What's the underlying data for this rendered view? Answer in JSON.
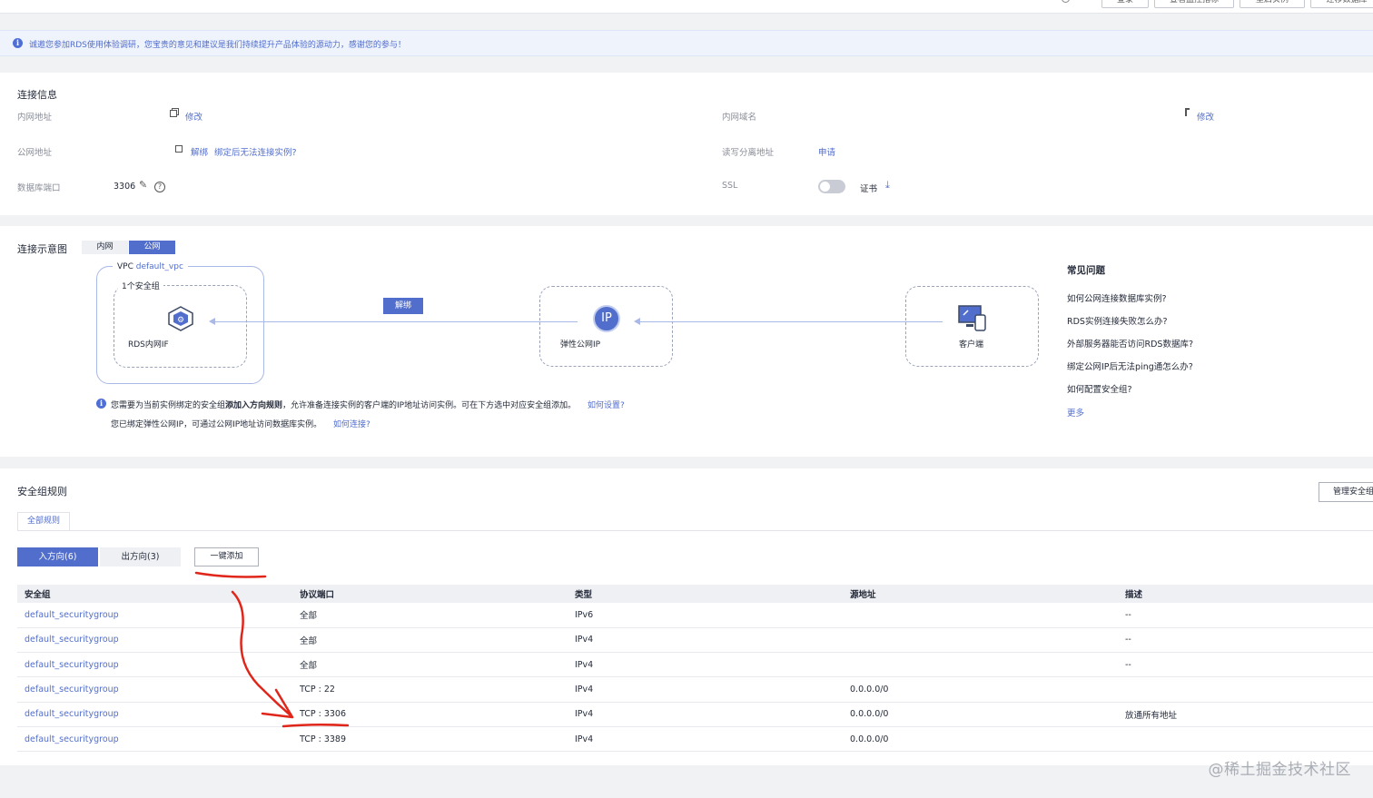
{
  "header": {
    "buttons": [
      {
        "label": "登录"
      },
      {
        "label": "查看监控指标"
      },
      {
        "label": "重启实例"
      },
      {
        "label": "迁移数据库"
      }
    ]
  },
  "banner": {
    "text": "诚邀您参加RDS使用体验调研，您宝贵的意见和建议是我们持续提升产品体验的源动力，感谢您的参与！"
  },
  "connection": {
    "title": "连接信息",
    "private_addr_label": "内网地址",
    "modify": "修改",
    "private_domain_label": "内网域名",
    "public_addr_label": "公网地址",
    "unbind": "解绑",
    "cannot_connect_link": "绑定后无法连接实例?",
    "rw_split_label": "读写分离地址",
    "apply": "申请",
    "port_label": "数据库端口",
    "port_value": "3306",
    "ssl_label": "SSL",
    "ssl_enabled": false,
    "cert_label": "证书"
  },
  "diagram": {
    "title": "连接示意图",
    "tabs": [
      {
        "label": "内网",
        "active": false
      },
      {
        "label": "公网",
        "active": true
      }
    ],
    "vpc_label": "VPC",
    "vpc_name": "default_vpc",
    "security_group_count": "1个安全组",
    "rds_label": "RDS内网IF",
    "unbind_badge": "解绑",
    "eip_label": "弹性公网IP",
    "eip_icon_text": "IP",
    "client_label": "客户端",
    "note1_a": "您需要为当前实例绑定的安全组",
    "note1_b": "添加入方向规则",
    "note1_c": "，允许准备连接实例的客户端的IP地址访问实例。可在下方选中对应安全组添加。",
    "note1_link": "如何设置?",
    "note2": "您已绑定弹性公网IP，可通过公网IP地址访问数据库实例。",
    "note2_link": "如何连接?"
  },
  "faq": {
    "title": "常见问题",
    "items": [
      "如何公网连接数据库实例?",
      "RDS实例连接失败怎么办?",
      "外部服务器能否访问RDS数据库?",
      "绑定公网IP后无法ping通怎么办?",
      "如何配置安全组?"
    ],
    "more": "更多"
  },
  "security": {
    "title": "安全组规则",
    "manage_button": "管理安全组",
    "filter_tab": "全部规则",
    "direction_tabs": [
      {
        "label": "入方向(6)",
        "active": true
      },
      {
        "label": "出方向(3)",
        "active": false
      }
    ],
    "quick_add": "一键添加",
    "columns": [
      "安全组",
      "协议端口",
      "类型",
      "源地址",
      "描述"
    ],
    "rows": [
      {
        "group": "default_securitygroup",
        "port": "全部",
        "type": "IPv6",
        "source": "",
        "desc": "--"
      },
      {
        "group": "default_securitygroup",
        "port": "全部",
        "type": "IPv4",
        "source": "",
        "desc": "--"
      },
      {
        "group": "default_securitygroup",
        "port": "全部",
        "type": "IPv4",
        "source": "",
        "desc": "--"
      },
      {
        "group": "default_securitygroup",
        "port": "TCP : 22",
        "type": "IPv4",
        "source": "0.0.0.0/0",
        "desc": ""
      },
      {
        "group": "default_securitygroup",
        "port": "TCP : 3306",
        "type": "IPv4",
        "source": "0.0.0.0/0",
        "desc": "放通所有地址"
      },
      {
        "group": "default_securitygroup",
        "port": "TCP : 3389",
        "type": "IPv4",
        "source": "0.0.0.0/0",
        "desc": ""
      }
    ]
  },
  "watermark": "@稀土掘金技术社区",
  "colors": {
    "accent": "#526ecc",
    "annotation": "#e0261a"
  }
}
